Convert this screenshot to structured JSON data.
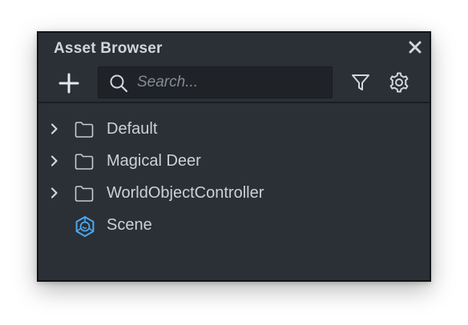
{
  "panel": {
    "title": "Asset Browser"
  },
  "toolbar": {
    "search_placeholder": "Search..."
  },
  "tree": {
    "items": [
      {
        "label": "Default",
        "type": "folder",
        "expandable": true
      },
      {
        "label": "Magical Deer",
        "type": "folder",
        "expandable": true
      },
      {
        "label": "WorldObjectController",
        "type": "folder",
        "expandable": true
      },
      {
        "label": "Scene",
        "type": "scene",
        "expandable": false
      }
    ]
  },
  "icons": {
    "close": "close-icon",
    "add": "plus-icon",
    "search": "search-icon",
    "filter": "filter-icon",
    "settings": "gear-icon",
    "folder": "folder-icon",
    "scene": "scene-icon",
    "chevron": "chevron-right-icon"
  },
  "colors": {
    "panel_bg": "#2b2f36",
    "search_bg": "#1f2227",
    "text": "#cdd1d7",
    "accent_scene": "#4aa8f0"
  }
}
